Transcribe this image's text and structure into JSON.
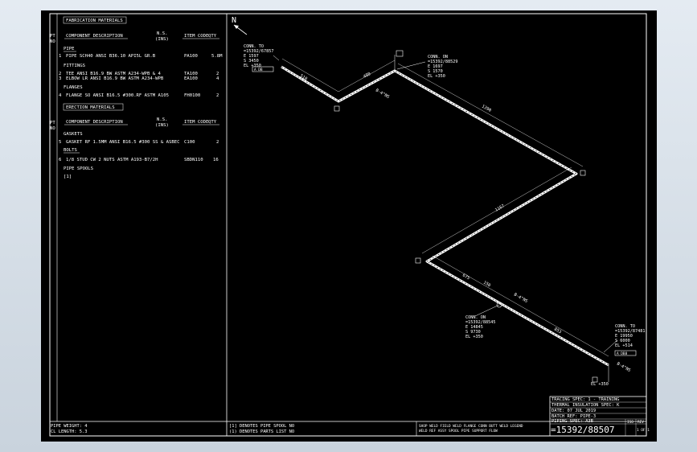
{
  "materials": {
    "fab_title": "FABRICATION MATERIALS",
    "col_pt": "PT",
    "col_no": "NO",
    "col_desc": "COMPONENT DESCRIPTION",
    "col_ns": "N.S.",
    "col_ns_unit": "(INS)",
    "col_item": "ITEM CODE",
    "col_qty": "QTY",
    "pipe_hdr": "PIPE",
    "pipe_row": {
      "pt": "1",
      "desc": "PIPE SCH40 ANSI B36.10 API5L GR.B",
      "item": "PA100",
      "qty": "5.8M"
    },
    "fittings_hdr": "FITTINGS",
    "fitting_rows": [
      {
        "pt": "2",
        "desc": "TEE ANSI B16.9 BW ASTM A234-WPB & 4",
        "item": "TA100",
        "qty": "2"
      },
      {
        "pt": "3",
        "desc": "ELBOW LR ANSI B16.9 BW ASTM A234-WPB",
        "item": "EA100",
        "qty": "4"
      }
    ],
    "flanges_hdr": "FLANGES",
    "flange_row": {
      "pt": "4",
      "desc": "FLANGE SO ANSI B16.5 #300.RF ASTM A105",
      "item": "FH0100",
      "qty": "2"
    },
    "erection_title": "ERECTION MATERIALS",
    "gaskets_hdr": "GASKETS",
    "gasket_row": {
      "pt": "5",
      "desc": "GASKET RF 1.5MM ANSI B16.5 #300 SS & ASBEC",
      "item": "C100",
      "qty": "2"
    },
    "bolts_hdr": "BOLTS",
    "bolt_row": {
      "pt": "6",
      "desc": "1/8 STUD CW 2 NUTS ASTM A193-B7/2H",
      "item": "SBDN110",
      "qty": "16"
    },
    "spools_hdr": "PIPE SPOOLS",
    "spool_row": "[1]"
  },
  "bottom": {
    "pipe_weight": "PIPE WEIGHT: 4",
    "cl_length": "CL LENGTH: 5.3",
    "note1": "[1] DENOTES PIPE SPOOL NO",
    "note2": "(1) DENOTES PARTS LIST NO",
    "legend1": "SHOP WELD  FIELD WELD  FLANGE CONN  BUTT WELD  LEGEND",
    "legend2": "WELD  REF  ASSY  SPOOL  PIPE SUPPORT  FLOW"
  },
  "title_block": {
    "lines": [
      "TRACING SPEC: 1 - TRAINING",
      "THERMAL INSULATION SPEC: K",
      "DATE: 07 JUL 2019",
      "BATCH REF: PIPE-3",
      "PIPING SPEC: A3B"
    ],
    "drawing_no": "=15392/88507",
    "iso": "ISO",
    "rev": "REV",
    "sheet": "1 OF 1"
  },
  "iso": {
    "north": "N",
    "conn1": [
      "CONN. TO",
      "=15392/67857",
      "E 1597",
      "S 3450",
      "EL +350"
    ],
    "conn2": [
      "CONN. ON",
      "=15392/88529",
      "E 1697",
      "S 1570",
      "EL +350"
    ],
    "conn3": [
      "CONN. ON",
      "=15392/88545",
      "E 14845",
      "S 9730",
      "EL +350"
    ],
    "conn4": [
      "CONN. TO",
      "=15392/87481",
      "E 19950",
      "S 6000",
      "EL +514"
    ],
    "dim_a": "510",
    "dim_b": "480",
    "dim_c": "1390",
    "dim_d": "1167",
    "dim_e": "675",
    "dim_f": "150",
    "dim_g": "853",
    "tag_a": "B-4\"NS",
    "tag_b": "B-4\"NS",
    "tag_c": "B-4\"NS",
    "el_d": "EL +350",
    "el_e": "EL +350",
    "flange_tag": "A DB",
    "flange_tag2": "A DB8"
  }
}
